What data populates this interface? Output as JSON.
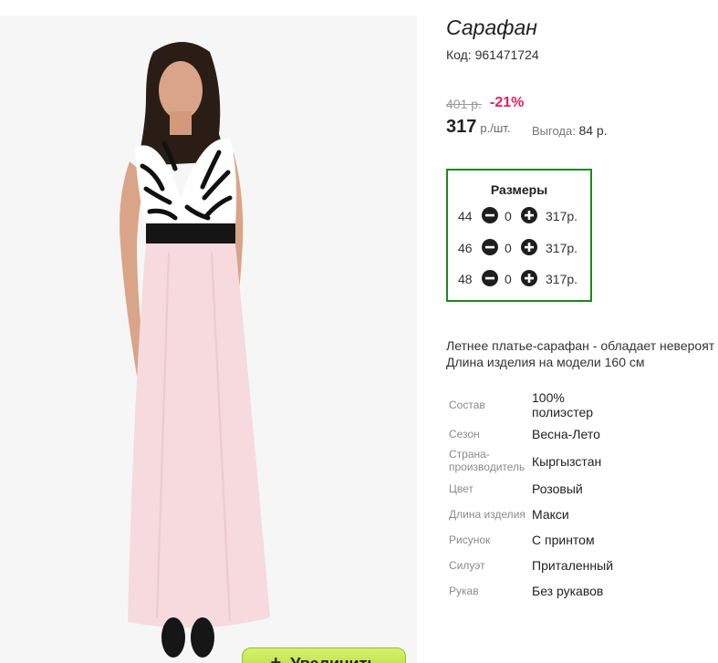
{
  "product": {
    "title": "Сарафан",
    "code": "Код: 961471724",
    "old_price": "401 р.",
    "discount": "-21%",
    "price": "317",
    "price_unit": "р./шт.",
    "savings_label": "Выгода:",
    "savings_value": "84 р.",
    "description_line1": "Летнее платье-сарафан - обладает невероят",
    "description_line2": "Длина изделия на модели 160 см"
  },
  "sizes": {
    "title": "Размеры",
    "rows": [
      {
        "size": "44",
        "qty": "0",
        "price": "317р."
      },
      {
        "size": "46",
        "qty": "0",
        "price": "317р."
      },
      {
        "size": "48",
        "qty": "0",
        "price": "317р."
      }
    ]
  },
  "specs": [
    {
      "key": "Состав",
      "value_line1": "100%",
      "value_line2": "полиэстер"
    },
    {
      "key": "Сезон",
      "value": "Весна-Лето"
    },
    {
      "key_line1": "Страна-",
      "key_line2": "производитель",
      "value": "Кыргызстан"
    },
    {
      "key": "Цвет",
      "value": "Розовый"
    },
    {
      "key": "Длина изделия",
      "value": "Макси"
    },
    {
      "key": "Рисунок",
      "value": "С принтом"
    },
    {
      "key": "Силуэт",
      "value": "Приталенный"
    },
    {
      "key": "Рукав",
      "value": "Без рукавов"
    }
  ],
  "gallery": {
    "zoom_label": "Увеличить"
  },
  "colors": {
    "accent_green": "#1b8a1b",
    "discount_red": "#e0245e",
    "button_green": "#a8d336"
  }
}
